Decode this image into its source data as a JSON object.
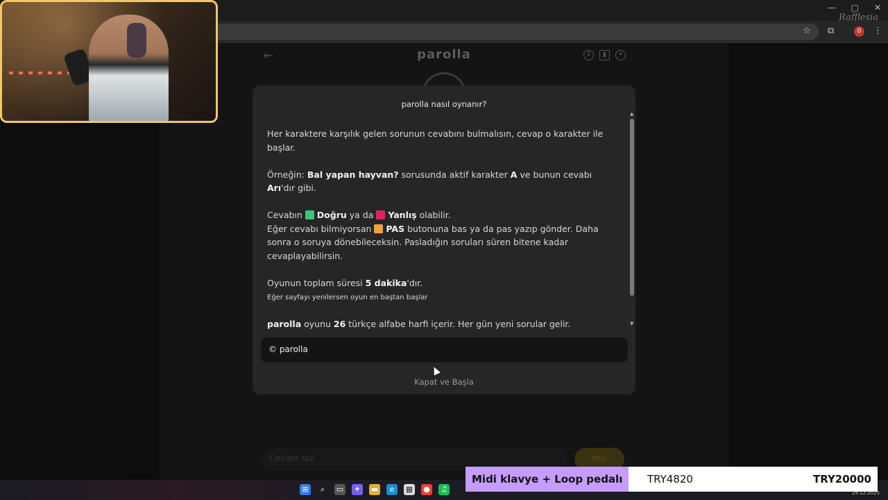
{
  "browser": {
    "window_controls": [
      "—",
      "▢",
      "✕"
    ],
    "extension_badge": "0",
    "watermark": "Rafflesia"
  },
  "app": {
    "title": "parolla",
    "answer_placeholder": "Cevabı Yaz",
    "pas_label": "PAS"
  },
  "modal": {
    "title": "parolla nasıl oynanır?",
    "p1": "Her karaktere karşılık gelen sorunun cevabını bulmalısın, cevap o karakter ile başlar.",
    "p2": {
      "prefix": "Örneğin: ",
      "question": "Bal yapan hayvan?",
      "mid": " sorusunda aktif karakter ",
      "letter": "A",
      "mid2": " ve bunun cevabı ",
      "answer": "Arı",
      "suffix": "'dır gibi."
    },
    "p3": {
      "prefix": "Cevabın ",
      "correct": "Doğru",
      "mid": " ya da ",
      "wrong": "Yanlış",
      "suffix": " olabilir.",
      "line2_prefix": "Eğer cevabı bilmiyorsan ",
      "pas": "PAS",
      "line2_suffix": " butonuna bas ya da pas yazıp gönder. Daha sonra o soruya dönebileceksin. Pasladığın soruları süren bitene kadar cevaplayabilirsin."
    },
    "p4": {
      "prefix": "Oyunun toplam süresi ",
      "duration": "5 dakika",
      "suffix": "'dır.",
      "note": "Eğer sayfayı yenilersen oyun en baştan başlar"
    },
    "p5": {
      "name": "parolla",
      "mid": " oyunu ",
      "count": "26",
      "suffix": " türkçe alfabe harfi içerir. Her gün yeni sorular gelir."
    },
    "footer": "© parolla",
    "close_label": "Kapat ve Başla",
    "colors": {
      "correct": "#3cc47c",
      "wrong": "#e0245e",
      "pas": "#f0a33a"
    }
  },
  "donation": {
    "item": "Midi klavye + Loop pedalı",
    "current": "TRY4820",
    "goal": "TRY20000"
  },
  "taskbar": {
    "time": "29.12.2025"
  }
}
